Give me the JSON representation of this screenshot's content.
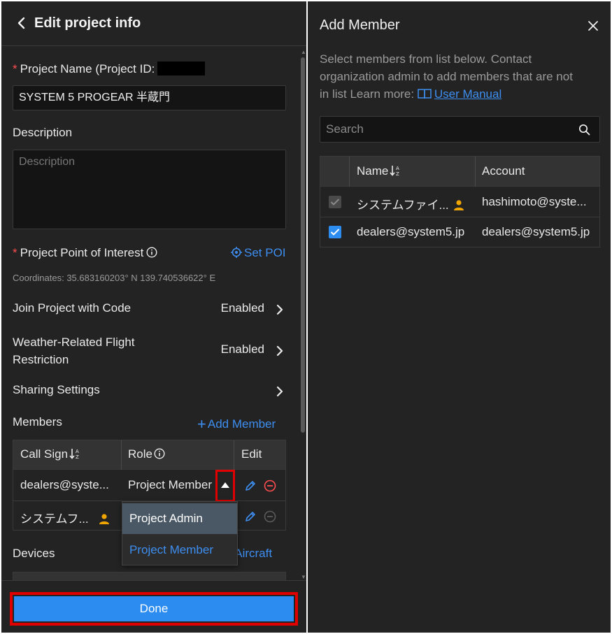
{
  "left": {
    "title": "Edit project info",
    "project_name": {
      "label": "Project Name (Project ID:",
      "required_mark": "*",
      "value": "SYSTEM 5 PROGEAR 半蔵門"
    },
    "description": {
      "label": "Description",
      "placeholder": "Description"
    },
    "poi": {
      "label": "Project Point of Interest",
      "required_mark": "*",
      "set_poi": "Set POI",
      "coordinates": "Coordinates: 35.683160203° N 139.740536622° E"
    },
    "join_code": {
      "label": "Join Project with Code",
      "value": "Enabled"
    },
    "weather": {
      "label_line1": "Weather-Related Flight",
      "label_line2": "Restriction",
      "value": "Enabled"
    },
    "sharing": {
      "label": "Sharing Settings"
    },
    "members": {
      "label": "Members",
      "add_member": "Add Member",
      "columns": {
        "call_sign": "Call Sign",
        "role": "Role",
        "edit": "Edit"
      },
      "rows": [
        {
          "call_sign": "dealers@syste...",
          "role": "Project Member"
        },
        {
          "call_sign": "システムフ...",
          "role": ""
        }
      ],
      "role_options": [
        "Project Admin",
        "Project Member"
      ]
    },
    "devices": {
      "label": "Devices",
      "add_aircraft": "d Aircraft"
    },
    "done": "Done"
  },
  "right": {
    "title": "Add Member",
    "description_line1": "Select members from list below. Contact",
    "description_line2": "organization admin to add members that are not",
    "description_line3": "in list Learn more:",
    "manual_link": "User Manual",
    "search_placeholder": "Search",
    "columns": {
      "name": "Name",
      "account": "Account"
    },
    "rows": [
      {
        "name": "システムファイ...",
        "account": "hashimoto@syste...",
        "state": "disabled"
      },
      {
        "name": "dealers@system5.jp",
        "account": "dealers@system5.jp",
        "state": "checked"
      }
    ]
  },
  "colors": {
    "accent": "#2d8cf0",
    "link": "#3d8ef0",
    "required": "#ff4d4f",
    "highlight": "#e00000",
    "user_icon": "#f0a500"
  }
}
